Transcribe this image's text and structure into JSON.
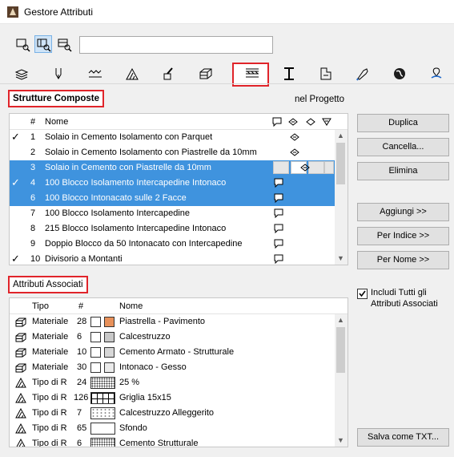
{
  "window": {
    "title": "Gestore Attributi"
  },
  "toolbar": {
    "view_buttons": [
      {
        "icon": "list-view-icon"
      },
      {
        "icon": "split-view-icon",
        "selected": true
      },
      {
        "icon": "preview-view-icon"
      }
    ],
    "search_value": ""
  },
  "tabs": [
    {
      "icon": "layers-icon"
    },
    {
      "icon": "pen-icon"
    },
    {
      "icon": "line-type-icon"
    },
    {
      "icon": "fill-icon"
    },
    {
      "icon": "surface-paint-icon"
    },
    {
      "icon": "building-material-icon"
    },
    {
      "icon": "composite-icon",
      "selected": true
    },
    {
      "icon": "profile-icon"
    },
    {
      "icon": "zone-category-icon"
    },
    {
      "icon": "mep-system-icon"
    },
    {
      "icon": "markup-style-icon"
    },
    {
      "icon": "location-icon"
    }
  ],
  "composites": {
    "label": "Strutture Composte",
    "scope": "nel Progetto",
    "columns": {
      "num": "#",
      "name": "Nome"
    },
    "rows": [
      {
        "check": "✓",
        "num": "1",
        "name": "Solaio in Cemento Isolamento con Parquet",
        "icon": "eye",
        "selected": false
      },
      {
        "check": "",
        "num": "2",
        "name": "Solaio in Cemento Isolamento con Piastrelle da 10mm",
        "icon": "eye",
        "selected": false
      },
      {
        "check": "",
        "num": "3",
        "name": "Solaio in Cemento con Piastrelle da 10mm",
        "icon": "eye-cell",
        "selected": true
      },
      {
        "check": "✓",
        "num": "4",
        "name": "100 Blocco Isolamento Intercapedine Intonaco",
        "icon": "flag",
        "selected": true
      },
      {
        "check": "",
        "num": "6",
        "name": "100 Blocco Intonacato sulle 2 Facce",
        "icon": "flag",
        "selected": true
      },
      {
        "check": "",
        "num": "7",
        "name": "100 Blocco Isolamento Intercapedine",
        "icon": "flag",
        "selected": false
      },
      {
        "check": "",
        "num": "8",
        "name": "215 Blocco Isolamento Intercapedine Intonaco",
        "icon": "flag",
        "selected": false
      },
      {
        "check": "",
        "num": "9",
        "name": "Doppio Blocco da 50 Intonacato con Intercapedine",
        "icon": "flag",
        "selected": false
      },
      {
        "check": "✓",
        "num": "10",
        "name": "Divisorio a Montanti",
        "icon": "flag",
        "selected": false
      }
    ]
  },
  "actions": {
    "duplicate": "Duplica",
    "delete": "Cancella...",
    "remove": "Elimina",
    "add": "Aggiungi >>",
    "by_index": "Per Indice >>",
    "by_name": "Per Nome >>",
    "include_all": "Includi Tutti gli Attributi Associati",
    "include_all_checked": true,
    "save_txt": "Salva come TXT..."
  },
  "associated": {
    "label": "Attributi Associati",
    "columns": {
      "type": "Tipo",
      "num": "#",
      "name": "Nome"
    },
    "rows": [
      {
        "icon": "building-material-icon",
        "type": "Materiale",
        "num": "28",
        "pattern": "dots",
        "swatch": "#e8915a",
        "name": "Piastrella - Pavimento"
      },
      {
        "icon": "building-material-icon",
        "type": "Materiale",
        "num": "6",
        "pattern": "dots",
        "swatch": "#c8c8c8",
        "name": "Calcestruzzo"
      },
      {
        "icon": "building-material-icon",
        "type": "Materiale",
        "num": "10",
        "pattern": "dots",
        "swatch": "#d7d7d7",
        "name": "Cemento Armato - Strutturale"
      },
      {
        "icon": "building-material-icon",
        "type": "Materiale",
        "num": "30",
        "pattern": "plain",
        "swatch": "#ebebeb",
        "name": "Intonaco - Gesso"
      },
      {
        "icon": "fill-icon",
        "type": "Tipo di R",
        "num": "24",
        "pattern": "dense",
        "swatch": "",
        "name": "25 %"
      },
      {
        "icon": "fill-icon",
        "type": "Tipo di R",
        "num": "126",
        "pattern": "grid",
        "swatch": "",
        "name": "Griglia 15x15"
      },
      {
        "icon": "fill-icon",
        "type": "Tipo di R",
        "num": "7",
        "pattern": "sparse",
        "swatch": "",
        "name": "Calcestruzzo Alleggerito"
      },
      {
        "icon": "fill-icon",
        "type": "Tipo di R",
        "num": "65",
        "pattern": "plain",
        "swatch": "",
        "name": "Sfondo"
      },
      {
        "icon": "fill-icon",
        "type": "Tipo di R",
        "num": "6",
        "pattern": "dense",
        "swatch": "",
        "name": "Cemento Strutturale"
      }
    ]
  }
}
